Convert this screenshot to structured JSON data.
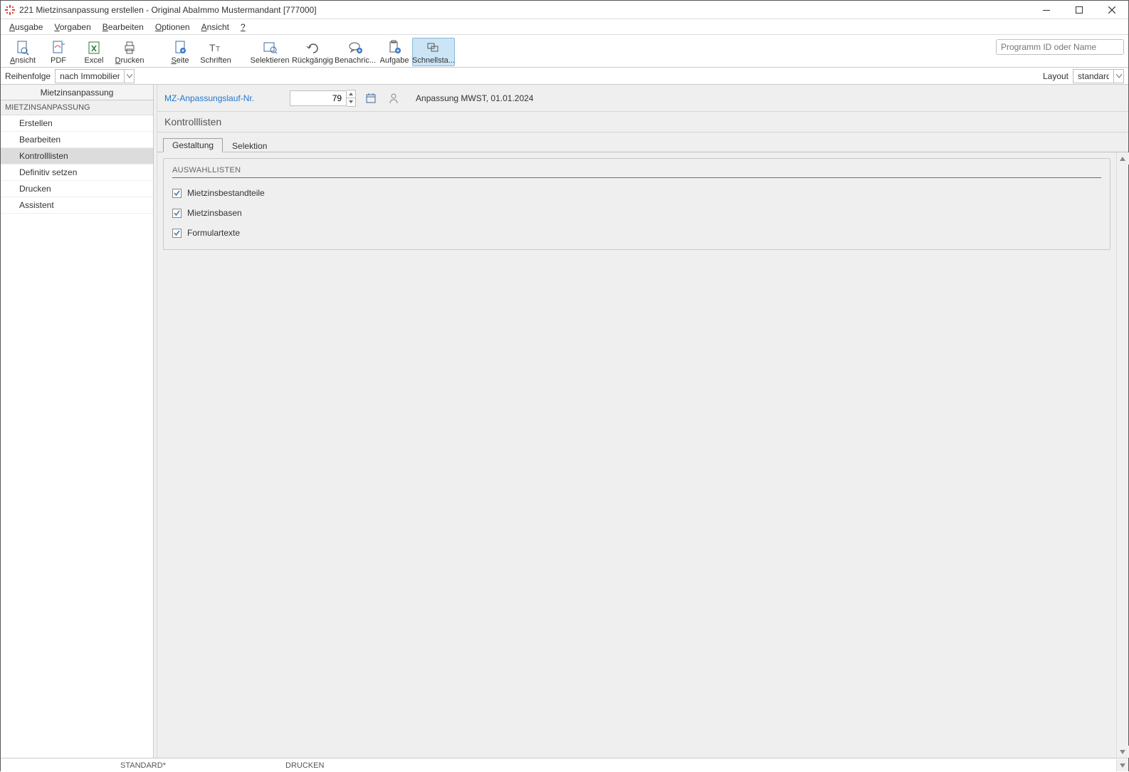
{
  "window": {
    "title": "221 Mietzinsanpassung erstellen - Original AbaImmo Mustermandant [777000]"
  },
  "menu": {
    "ausgabe": "Ausgabe",
    "vorgaben": "Vorgaben",
    "bearbeiten": "Bearbeiten",
    "optionen": "Optionen",
    "ansicht": "Ansicht",
    "help": "?"
  },
  "toolbar": {
    "ansicht": "Ansicht",
    "pdf": "PDF",
    "excel": "Excel",
    "drucken": "Drucken",
    "seite": "Seite",
    "schriften": "Schriften",
    "selektieren": "Selektieren",
    "rueckgaengig": "Rückgängig",
    "benachric": "Benachric...",
    "aufgabe": "Aufgabe",
    "schnellsta": "Schnellsta...",
    "search_placeholder": "Programm ID oder Name"
  },
  "sortbar": {
    "label": "Reihenfolge",
    "value": "nach Immobilien-Nr.",
    "layout_label": "Layout",
    "layout_value": "standard"
  },
  "sidebar": {
    "title": "Mietzinsanpassung",
    "section": "MIETZINSANPASSUNG",
    "items": [
      {
        "label": "Erstellen"
      },
      {
        "label": "Bearbeiten"
      },
      {
        "label": "Kontrolllisten"
      },
      {
        "label": "Definitiv setzen"
      },
      {
        "label": "Drucken"
      },
      {
        "label": "Assistent"
      }
    ],
    "selected_index": 2
  },
  "context": {
    "link": "MZ-Anpassungslauf-Nr.",
    "value": "79",
    "description": "Anpassung MWST, 01.01.2024"
  },
  "section_title": "Kontrolllisten",
  "tabs": {
    "gestaltung": "Gestaltung",
    "selektion": "Selektion",
    "active": 0
  },
  "panel": {
    "title": "AUSWAHLLISTEN",
    "checks": [
      {
        "label": "Mietzinsbestandteile",
        "checked": true
      },
      {
        "label": "Mietzinsbasen",
        "checked": true
      },
      {
        "label": "Formulartexte",
        "checked": true
      }
    ]
  },
  "status": {
    "cell1": "STANDARD*",
    "cell2": "DRUCKEN"
  }
}
